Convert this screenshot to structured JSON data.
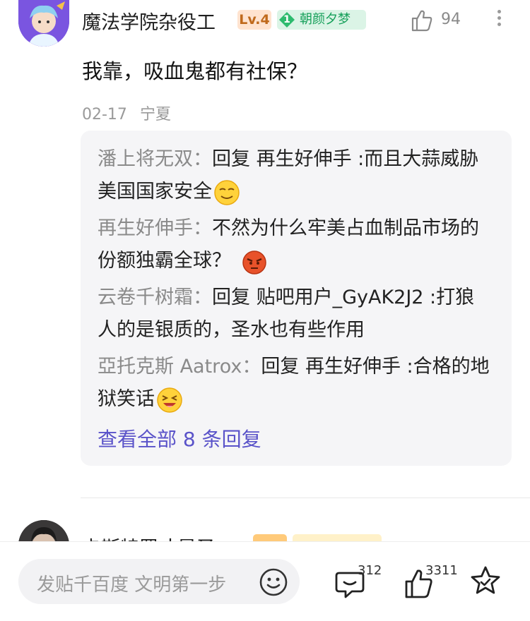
{
  "post": {
    "username": "魔法学院杂役工",
    "level_badge": "Lv.4",
    "fan_level": "1",
    "fan_badge": "朝颜夕梦",
    "like_count": "94",
    "content": "我靠，吸血鬼都有社保？",
    "date": "02-17",
    "location": "宁夏"
  },
  "replies": [
    {
      "author": "潘上将无双",
      "sep": "：",
      "text": "回复 再生好伸手 :而且大蒜威胁美国国家安全",
      "emoji": "smug-face"
    },
    {
      "author": "再生好伸手",
      "sep": "：",
      "text": "不然为什么牢美占血制品市场的份额独霸全球？",
      "emoji": "angry-face"
    },
    {
      "author": "云卷千树霜",
      "sep": "：",
      "text": "回复 贴吧用户_GyAK2J2 :打狼人的是银质的，圣水也有些作用",
      "emoji": ""
    },
    {
      "author": "亞托克斯 Aatrox",
      "sep": "：",
      "text": "回复 再生好伸手 :合格的地狱笑话",
      "emoji": "laughing-face"
    }
  ],
  "view_all": "查看全部 8 条回复",
  "next_post": {
    "username": "卡斯特罗才是圣"
  },
  "bottom_bar": {
    "input_placeholder": "发贴千百度 文明第一步",
    "comment_count": "312",
    "like_count": "3311"
  },
  "colors": {
    "link": "#5a53c9",
    "author": "#8a8a8a",
    "fan_badge": "#16a05a",
    "level_badge": "#c06a1c"
  }
}
